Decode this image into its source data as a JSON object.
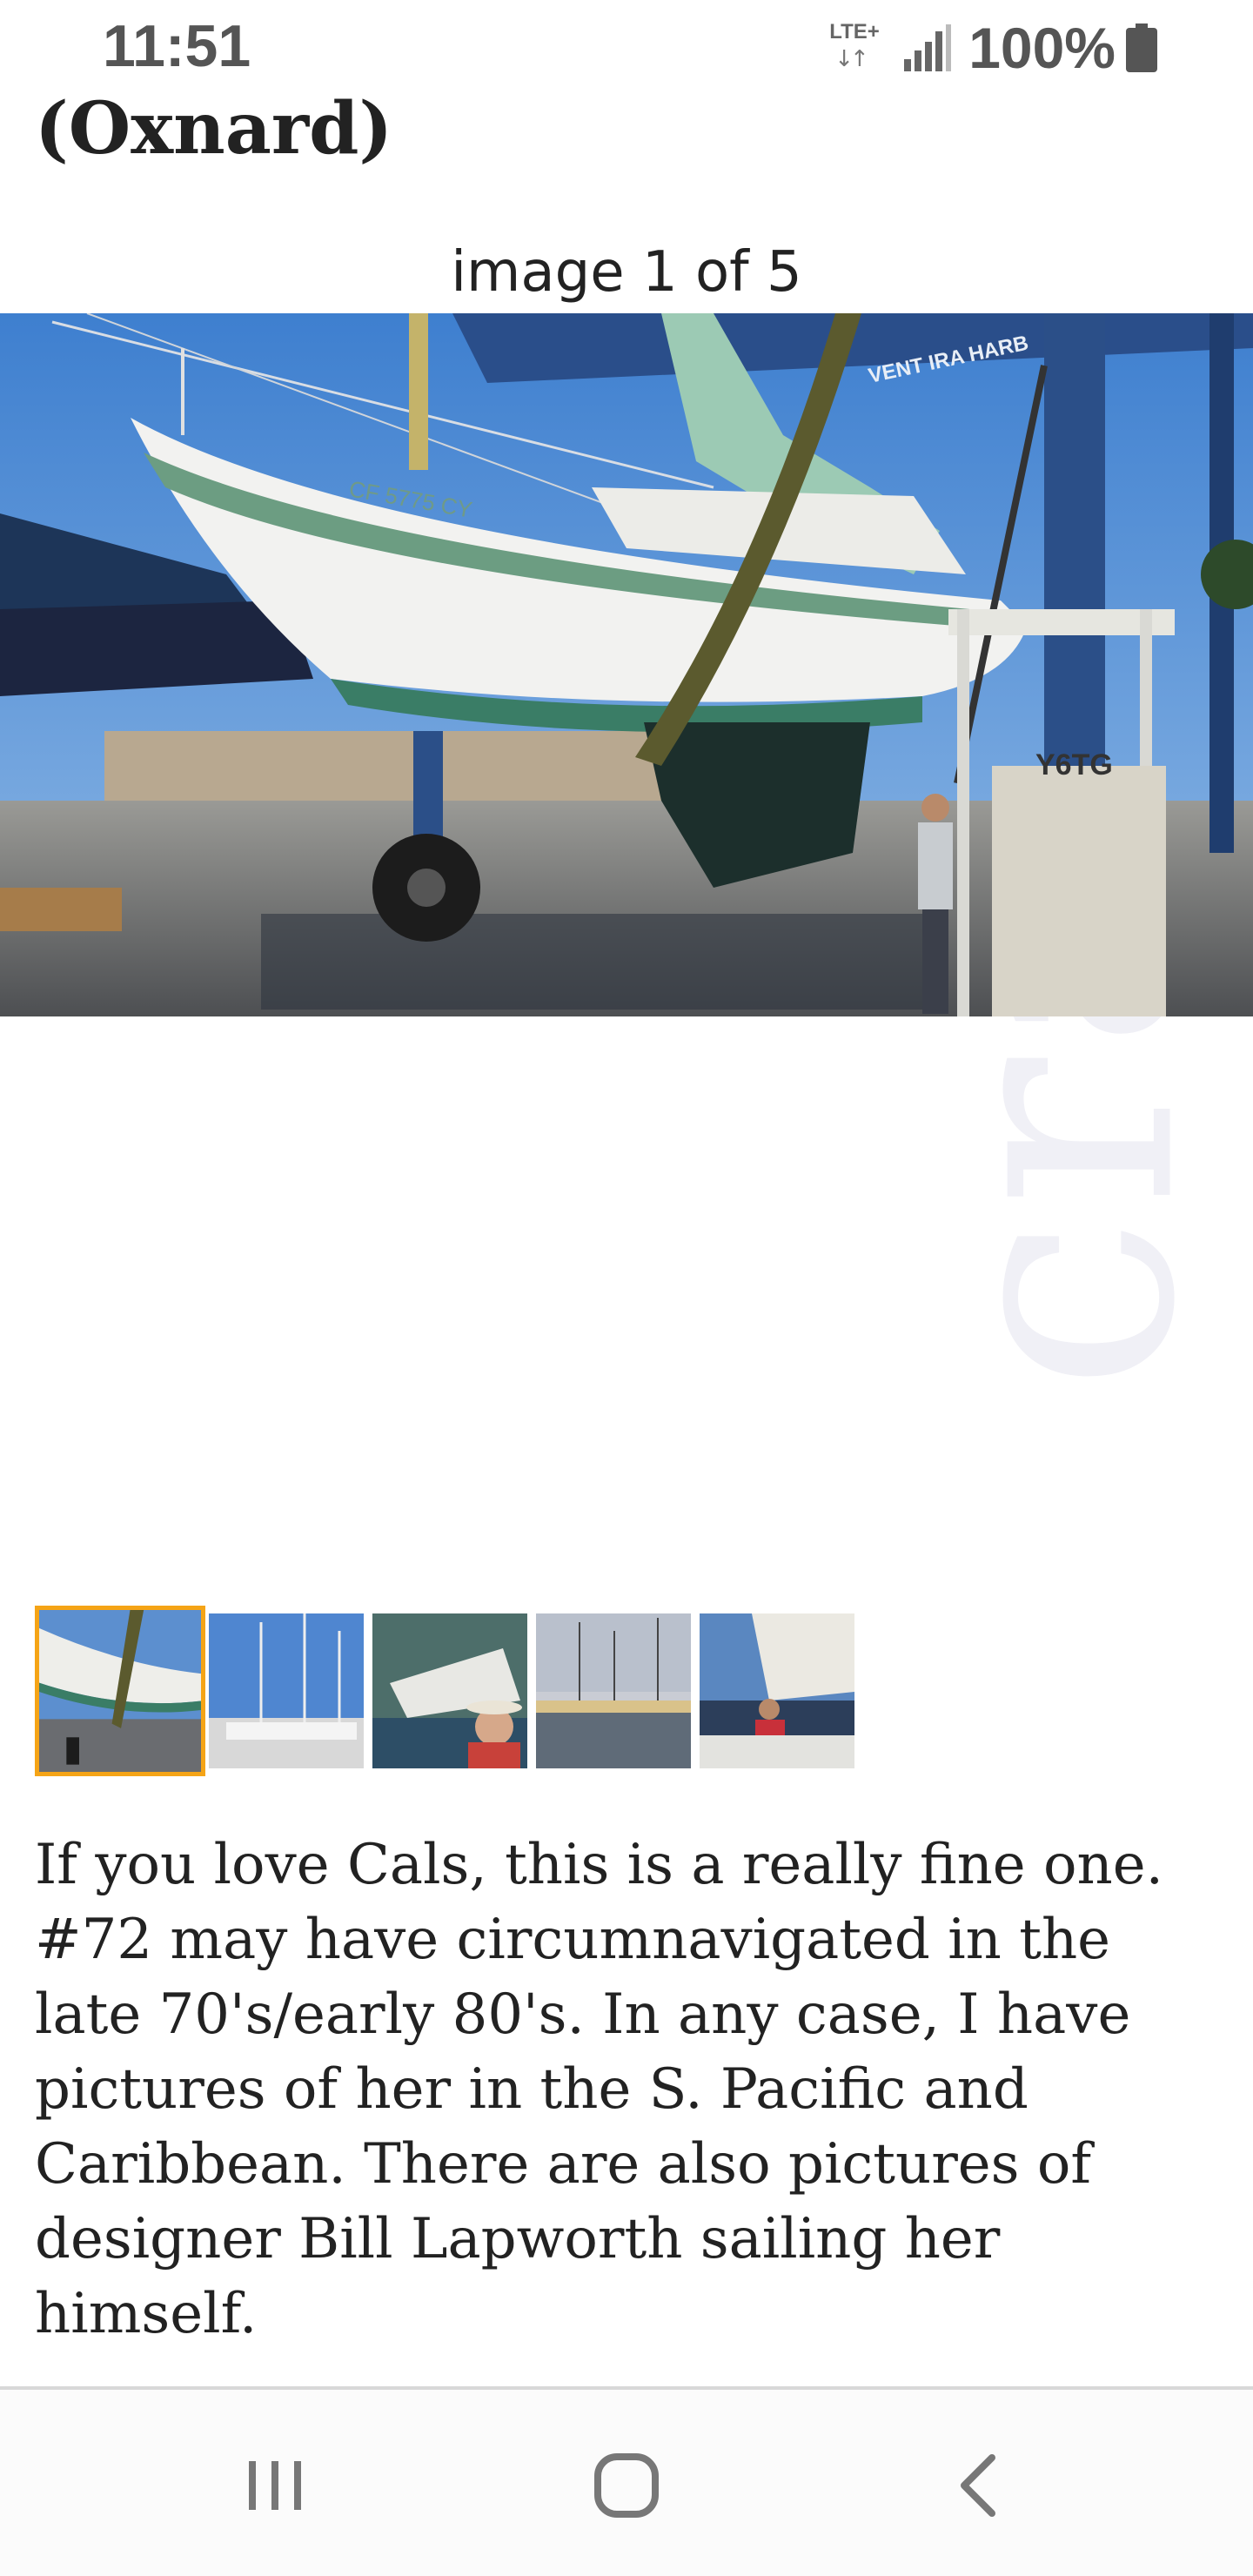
{
  "status_bar": {
    "time": "11:51",
    "network": "LTE+",
    "network_arrows": "↓↑",
    "battery": "100%"
  },
  "posting": {
    "title": "(Oxnard)",
    "image_counter": "image 1 of 5",
    "images_total": 5,
    "selected_image_index": 1,
    "main_image_alt": "Sailboat on travel lift with straps at boatyard; hull number CF 5775 CY",
    "hull_number": "CF 5775 CY",
    "yard_sign": "VENT IRA HARB",
    "lift_sign": "Y6TG",
    "thumbnails": [
      {
        "label": "Sailboat on travel lift"
      },
      {
        "label": "Masts in marina"
      },
      {
        "label": "Person sailing boat"
      },
      {
        "label": "Marina at sunset"
      },
      {
        "label": "Sailing on deck"
      }
    ],
    "description": "If you love Cals, this is a really fine one. #72 may have circumnavigated in the late 70's/early 80's. In any case, I have pictures of her in the S. Pacific and Caribbean. There are also pictures of designer Bill Lapworth sailing her himself.",
    "watermark": "craigs"
  },
  "nav_bar": {
    "recents_icon": "recent-apps-icon",
    "home_icon": "home-icon",
    "back_icon": "back-icon"
  },
  "colors": {
    "selected_thumb_border": "#f5a416",
    "text": "#222222",
    "status_text": "#555555"
  }
}
